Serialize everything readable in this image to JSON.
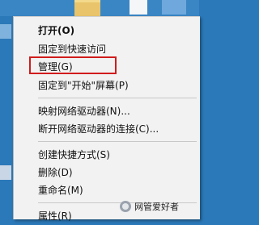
{
  "menu": {
    "items": [
      {
        "label": "打开(O)",
        "bold": true
      },
      {
        "label": "固定到快速访问",
        "bold": false
      },
      {
        "label": "管理(G)",
        "bold": false
      },
      {
        "label": "固定到\"开始\"屏幕(P)",
        "bold": false
      },
      {
        "label": "映射网络驱动器(N)...",
        "bold": false
      },
      {
        "label": "断开网络驱动器的连接(C)...",
        "bold": false
      },
      {
        "label": "创建快捷方式(S)",
        "bold": false
      },
      {
        "label": "删除(D)",
        "bold": false
      },
      {
        "label": "重命名(M)",
        "bold": false
      },
      {
        "label": "属性(R)",
        "bold": false
      }
    ]
  },
  "watermark": {
    "text": "网管爱好者"
  },
  "colors": {
    "highlight_border": "#d11c1c",
    "menu_bg": "#f2f2f2"
  }
}
